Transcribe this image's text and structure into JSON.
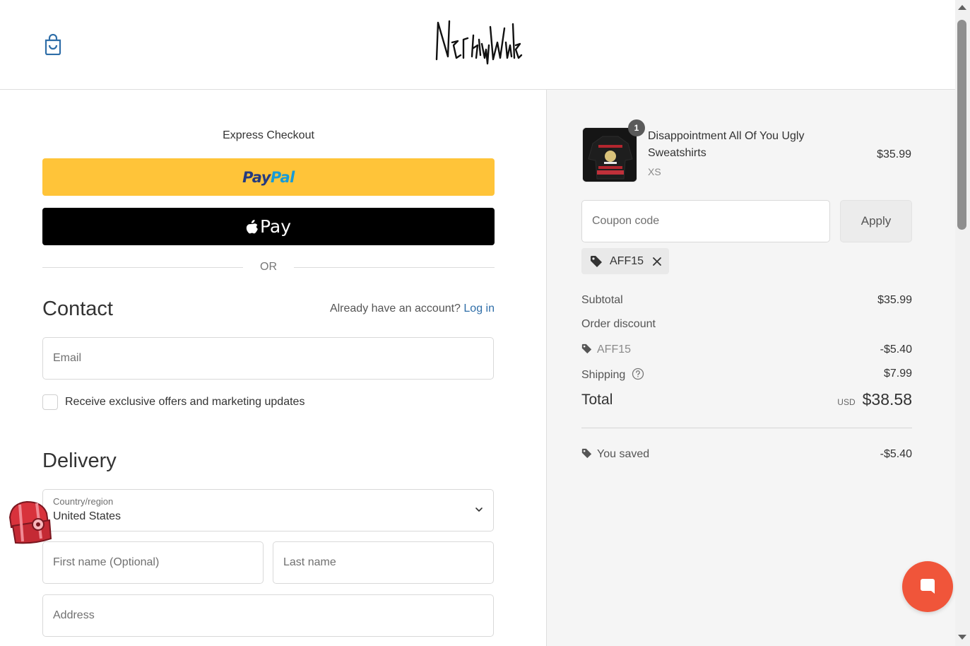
{
  "header": {
    "logo_text": "NerdyWave",
    "cart_icon": "shopping-bag-icon"
  },
  "express": {
    "title": "Express Checkout",
    "paypal_label_a": "Pay",
    "paypal_label_b": "Pal",
    "applepay_label": "Pay",
    "or_text": "OR",
    "colors": {
      "paypal": "#ffc439",
      "applepay": "#000000"
    }
  },
  "contact": {
    "heading": "Contact",
    "account_prompt": "Already have an account?",
    "login_link": "Log in",
    "email_placeholder": "Email",
    "marketing_label": "Receive exclusive offers and marketing updates",
    "marketing_checked": false
  },
  "delivery": {
    "heading": "Delivery",
    "country_label": "Country/region",
    "country_value": "United States",
    "first_name_placeholder": "First name (Optional)",
    "last_name_placeholder": "Last name",
    "address_placeholder": "Address"
  },
  "order": {
    "item": {
      "name": "Disappointment All Of You Ugly Sweatshirts",
      "variant": "XS",
      "price": "$35.99",
      "quantity": "1"
    },
    "coupon_placeholder": "Coupon code",
    "apply_label": "Apply",
    "applied_code": "AFF15",
    "summary": {
      "subtotal_label": "Subtotal",
      "subtotal_value": "$35.99",
      "discount_label": "Order discount",
      "discount_code": "AFF15",
      "discount_value": "-$5.40",
      "shipping_label": "Shipping",
      "shipping_value": "$7.99",
      "total_label": "Total",
      "currency": "USD",
      "total_value": "$38.58",
      "saved_label": "You saved",
      "saved_value": "-$5.40"
    }
  },
  "colors": {
    "accent_link": "#2f6ea8",
    "chat_bubble": "#f0553a"
  }
}
